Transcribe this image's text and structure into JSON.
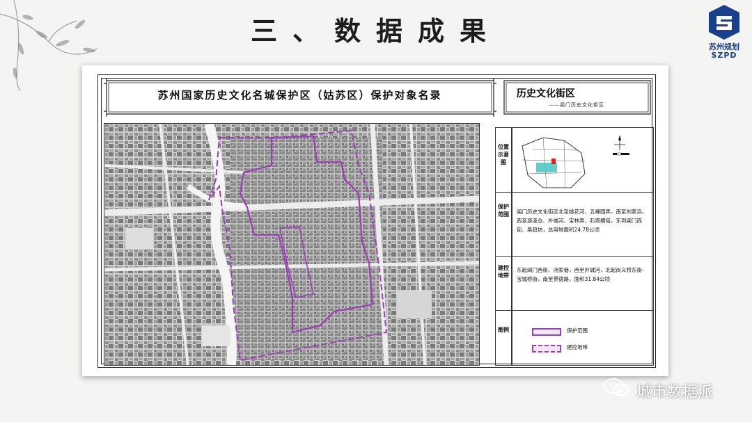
{
  "slide": {
    "title": "三、数据成果"
  },
  "logo": {
    "name_cn": "苏州规划",
    "name_en": "SZPD",
    "color": "#1a3f8c"
  },
  "map_sheet": {
    "title": "苏州国家历史文化名城保护区（姑苏区）保护对象名录",
    "category": "历史文化街区",
    "subtitle": "——阊门历史文化街区",
    "side_labels": {
      "location": "位置示意图",
      "protection": "保护范围",
      "control": "建控地带",
      "legend": "图例"
    },
    "protection_text": "阊门历史文化街区北至桃花河、五峰园弄，南至刘家浜，西至游溪仓、外城河、宝林弄、石塔横街，东到阊门西街、吴趋坊，总用地面积24.78公顷",
    "control_text": "东起阊门西街、汤家巷，西至外城河，北起尚义桥东街-宝城桥街，南至景德路，面积31.84公顷",
    "legend": [
      {
        "label": "保护范围",
        "style": "solid"
      },
      {
        "label": "建控地带",
        "style": "dashed"
      }
    ],
    "boundary_color": "#9b3fb5",
    "highlight_color": "#3fbfbf"
  },
  "watermark": {
    "text": "城市数据派"
  }
}
